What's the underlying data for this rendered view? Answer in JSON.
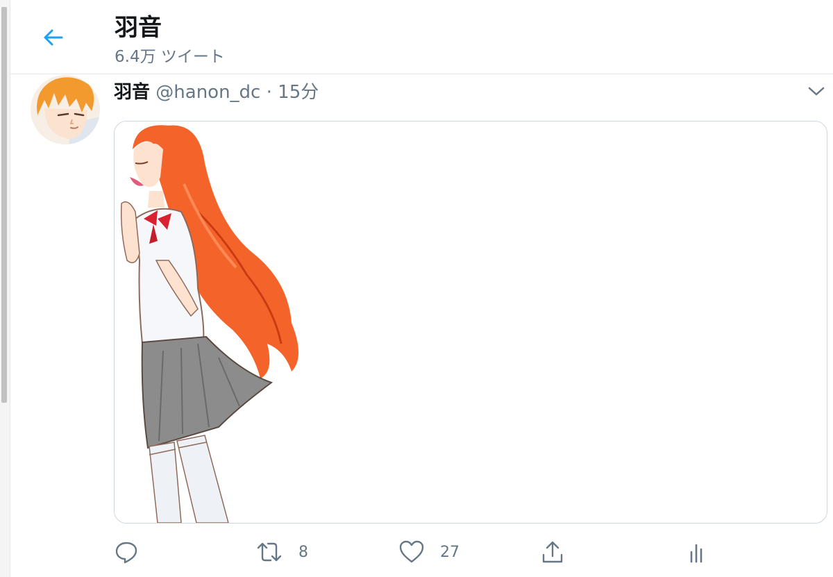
{
  "header": {
    "title": "羽音",
    "subtitle": "6.4万 ツイート",
    "back_icon": "arrow-left-icon"
  },
  "tweet": {
    "name": "羽音",
    "handle": "@hanon_dc",
    "separator": "·",
    "time": "15分",
    "avatar": "avatar-illustration",
    "menu_icon": "chevron-down-icon",
    "media": "illustration-girl-orange-hair-school-uniform"
  },
  "actions": {
    "reply": {
      "icon": "reply-icon",
      "count": ""
    },
    "retweet": {
      "icon": "retweet-icon",
      "count": "8"
    },
    "like": {
      "icon": "heart-icon",
      "count": "27"
    },
    "share": {
      "icon": "share-icon",
      "count": ""
    },
    "analytics": {
      "icon": "analytics-icon",
      "count": ""
    }
  },
  "colors": {
    "accent": "#1da1f2",
    "text_primary": "#14171a",
    "text_secondary": "#657786",
    "border": "#ccd6dd",
    "hair": "#f4642a"
  }
}
